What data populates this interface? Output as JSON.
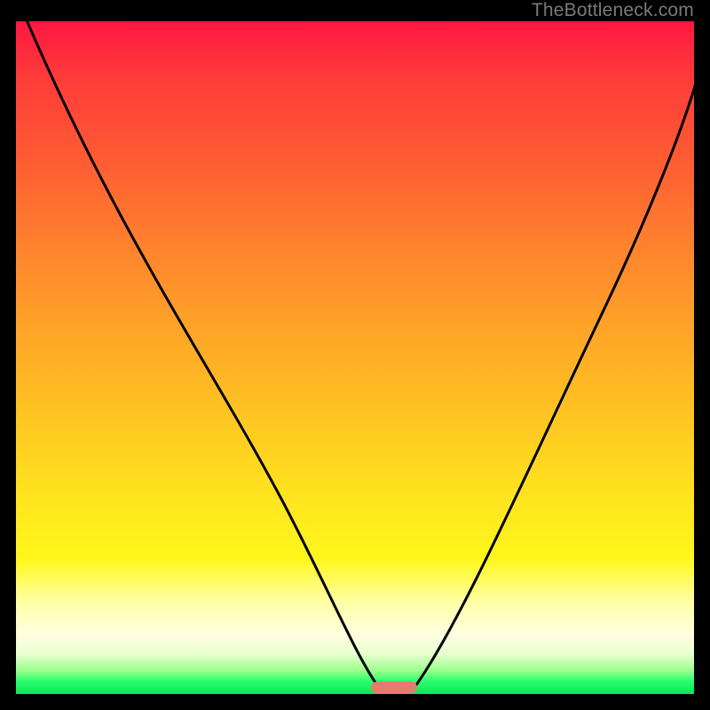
{
  "watermark": "TheBottleneck.com",
  "colors": {
    "frame": "#000000",
    "curve": "#000000",
    "marker": "#e77a72",
    "watermark": "#7a7a7a",
    "gradient_top": "#ff1740",
    "gradient_mid": "#ffe21e",
    "gradient_bottom": "#08e65a"
  },
  "chart_data": {
    "type": "line",
    "title": "",
    "xlabel": "",
    "ylabel": "",
    "xlim": [
      0,
      100
    ],
    "ylim": [
      0,
      100
    ],
    "grid": false,
    "legend": false,
    "x": [
      0,
      5,
      10,
      15,
      20,
      25,
      30,
      35,
      40,
      45,
      50,
      52.5,
      55,
      60,
      65,
      70,
      75,
      80,
      85,
      90,
      95,
      100
    ],
    "y": [
      100,
      92,
      83,
      74,
      65,
      56,
      47,
      38,
      29,
      20,
      11,
      3,
      0,
      0,
      3,
      11,
      22,
      34,
      46,
      58,
      70,
      82
    ],
    "marker_x_range": [
      51,
      59
    ],
    "marker_y": 0,
    "annotations": []
  }
}
